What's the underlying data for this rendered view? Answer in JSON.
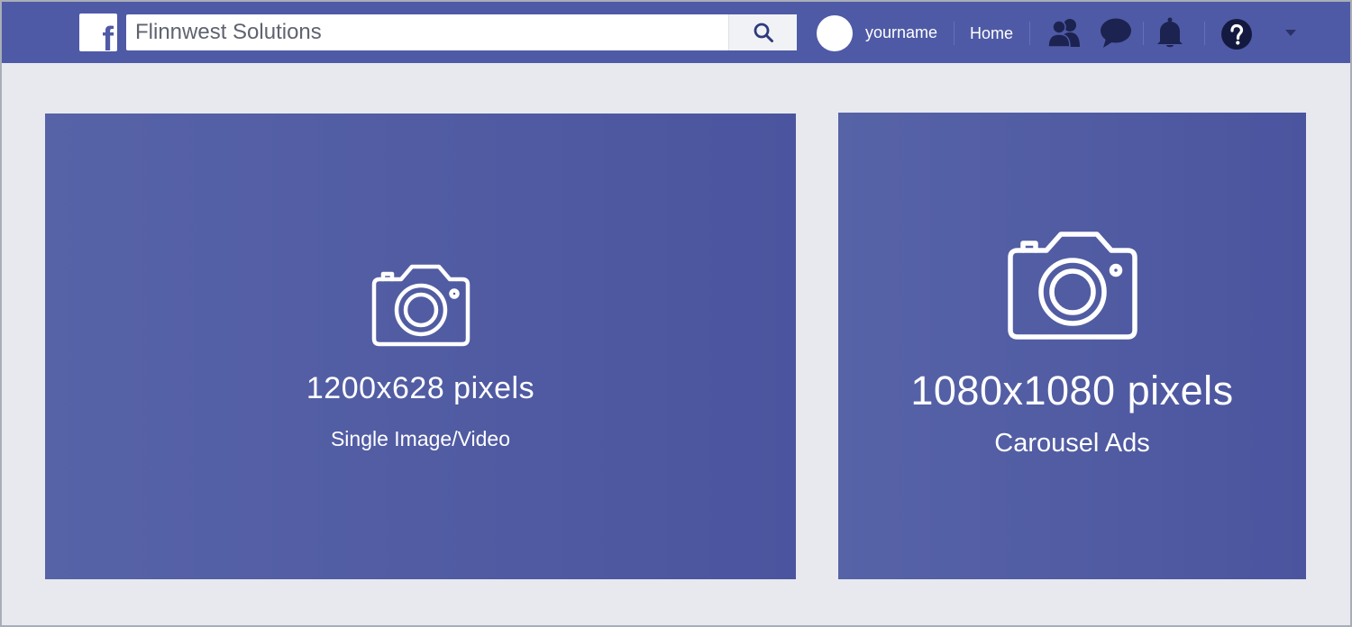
{
  "header": {
    "logo_letter": "f",
    "search": {
      "value": "Flinnwest Solutions",
      "placeholder": ""
    },
    "username": "yourname",
    "home_label": "Home",
    "brand_color": "#4f5aa6",
    "icons": [
      "search-icon",
      "friends-icon",
      "messages-icon",
      "notifications-icon",
      "help-icon",
      "dropdown-caret-icon"
    ]
  },
  "panels": [
    {
      "size": "1200x628 pixels",
      "description": "Single Image/Video",
      "icon": "camera-icon"
    },
    {
      "size": "1080x1080 pixels",
      "description": "Carousel Ads",
      "icon": "camera-icon"
    }
  ]
}
